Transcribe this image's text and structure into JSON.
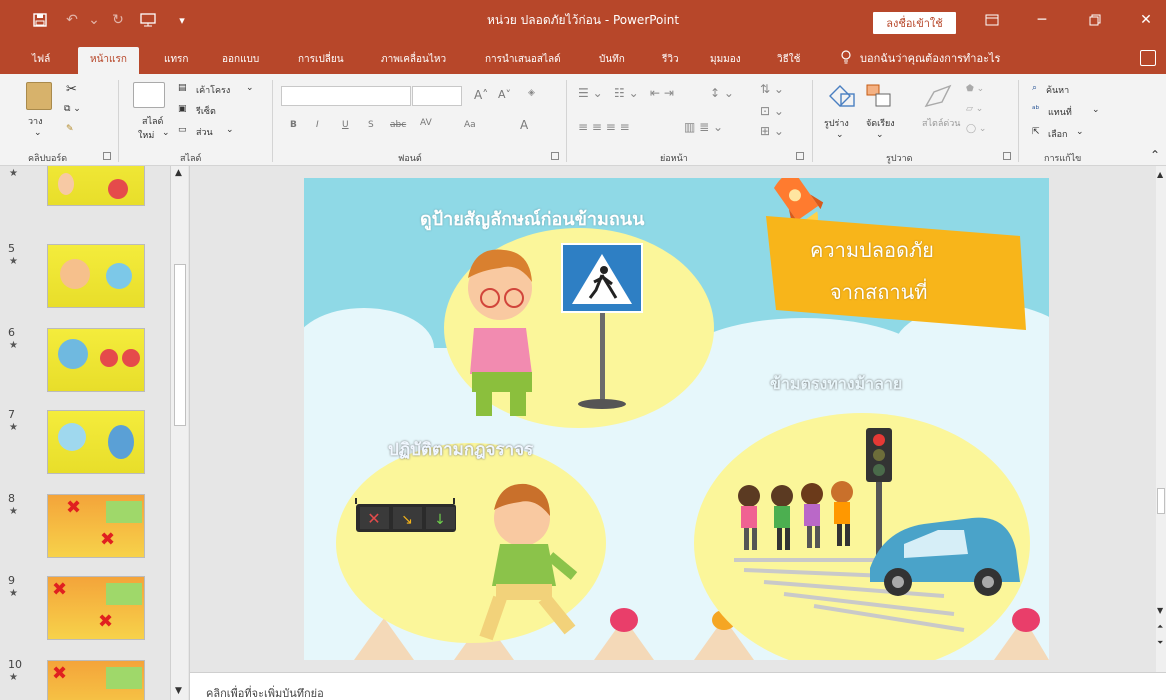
{
  "window": {
    "title": "หน่วย ปลอดภัยไว้ก่อน  -  PowerPoint",
    "signin_label": "ลงชื่อเข้าใช้"
  },
  "tabs": [
    "ไฟล์",
    "หน้าแรก",
    "แทรก",
    "ออกแบบ",
    "การเปลี่ยน",
    "ภาพเคลื่อนไหว",
    "การนำเสนอสไลด์",
    "บันทึก",
    "รีวิว",
    "มุมมอง",
    "วิธีใช้"
  ],
  "tell_me": "บอกฉันว่าคุณต้องการทำอะไร",
  "ribbon": {
    "clipboard": {
      "label": "คลิปบอร์ด",
      "paste": "วาง"
    },
    "slides": {
      "label": "สไลด์",
      "new_slide_1": "สไลด์",
      "new_slide_2": "ใหม่",
      "layout": "เค้าโครง",
      "reset": "รีเซ็ต",
      "section": "ส่วน"
    },
    "font": {
      "label": "ฟอนต์",
      "bold": "B",
      "italic": "I",
      "underline": "U",
      "strike": "S",
      "abc": "abc",
      "spacing": "AV",
      "case": "Aa",
      "color": "A"
    },
    "paragraph": {
      "label": "ย่อหน้า"
    },
    "drawing": {
      "label": "รูปวาด",
      "shapes": "รูปร่าง",
      "arrange": "จัดเรียง",
      "styles": "สไตล์ด่วน"
    },
    "editing": {
      "label": "การแก้ไข",
      "find": "ค้นหา",
      "replace": "แทนที่",
      "select": "เลือก"
    }
  },
  "thumbnails": [
    {
      "num": "",
      "star": "★",
      "style": "yel"
    },
    {
      "num": "5",
      "star": "★",
      "style": "yel"
    },
    {
      "num": "6",
      "star": "★",
      "style": "yel"
    },
    {
      "num": "7",
      "star": "★",
      "style": "yel"
    },
    {
      "num": "8",
      "star": "★",
      "style": "org"
    },
    {
      "num": "9",
      "star": "★",
      "style": "org"
    },
    {
      "num": "10",
      "star": "★",
      "style": "org"
    }
  ],
  "slide": {
    "title_top": "ดูป้ายสัญลักษณ์ก่อนข้ามถนน",
    "banner_line1": "ความปลอดภัย",
    "banner_line2": "จากสถานที่",
    "title_right": "ข้ามตรงทางม้าลาย",
    "title_bottom": "ปฏิบัติตามกฎจราจร"
  },
  "notes_placeholder": "คลิกเพื่อที่จะเพิ่มบันทึกย่อ",
  "colors": {
    "accent": "#b7472a",
    "banner": "#f8b51a",
    "circle": "#fbf69a",
    "sky": "#8fd9e6"
  }
}
